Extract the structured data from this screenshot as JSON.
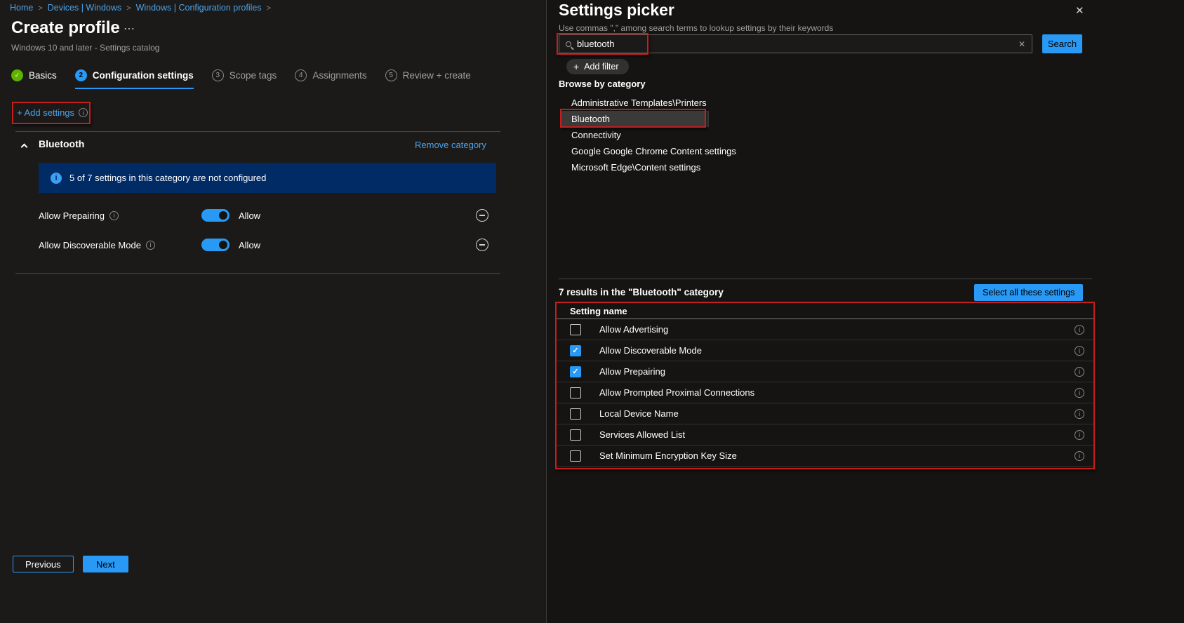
{
  "icons": {
    "separator": ">",
    "ellipsis": "⋯",
    "close": "✕",
    "clear": "✕",
    "plus": "+",
    "check": "✓"
  },
  "colors": {
    "accent": "#2899f5",
    "link": "#4ca2e8",
    "annotation_red": "#c41e1e",
    "banner_bg": "#012b65",
    "success_green": "#5db300",
    "selected_row": "#3b3a39"
  },
  "breadcrumb": {
    "items": [
      "Home",
      "Devices | Windows",
      "Windows | Configuration profiles"
    ]
  },
  "header": {
    "title": "Create profile",
    "subtitle": "Windows 10 and later - Settings catalog"
  },
  "steps": [
    {
      "label": "Basics",
      "badge": "✓",
      "state": "done"
    },
    {
      "label": "Configuration settings",
      "badge": "2",
      "state": "active"
    },
    {
      "label": "Scope tags",
      "badge": "3",
      "state": "future"
    },
    {
      "label": "Assignments",
      "badge": "4",
      "state": "future"
    },
    {
      "label": "Review + create",
      "badge": "5",
      "state": "future"
    }
  ],
  "add_settings": {
    "label": "+ Add settings"
  },
  "category_section": {
    "title": "Bluetooth",
    "remove_label": "Remove category",
    "banner": "5 of 7 settings in this category are not configured",
    "settings": [
      {
        "label": "Allow Prepairing",
        "value": "Allow",
        "enabled": true
      },
      {
        "label": "Allow Discoverable Mode",
        "value": "Allow",
        "enabled": true
      }
    ]
  },
  "footer": {
    "previous": "Previous",
    "next": "Next"
  },
  "picker": {
    "title": "Settings picker",
    "subtitle": "Use commas \",\" among search terms to lookup settings by their keywords",
    "search": {
      "value": "bluetooth",
      "button": "Search"
    },
    "add_filter": "Add filter",
    "browse_label": "Browse by category",
    "categories": [
      "Administrative Templates\\Printers",
      "Bluetooth",
      "Connectivity",
      "Google Google Chrome Content settings",
      "Microsoft Edge\\Content settings"
    ],
    "selected_category_index": 1,
    "results_label": "7 results in the \"Bluetooth\" category",
    "select_all_label": "Select all these settings",
    "table_header": "Setting name",
    "rows": [
      {
        "label": "Allow Advertising",
        "checked": false
      },
      {
        "label": "Allow Discoverable Mode",
        "checked": true
      },
      {
        "label": "Allow Prepairing",
        "checked": true
      },
      {
        "label": "Allow Prompted Proximal Connections",
        "checked": false
      },
      {
        "label": "Local Device Name",
        "checked": false
      },
      {
        "label": "Services Allowed List",
        "checked": false
      },
      {
        "label": "Set Minimum Encryption Key Size",
        "checked": false
      }
    ]
  }
}
